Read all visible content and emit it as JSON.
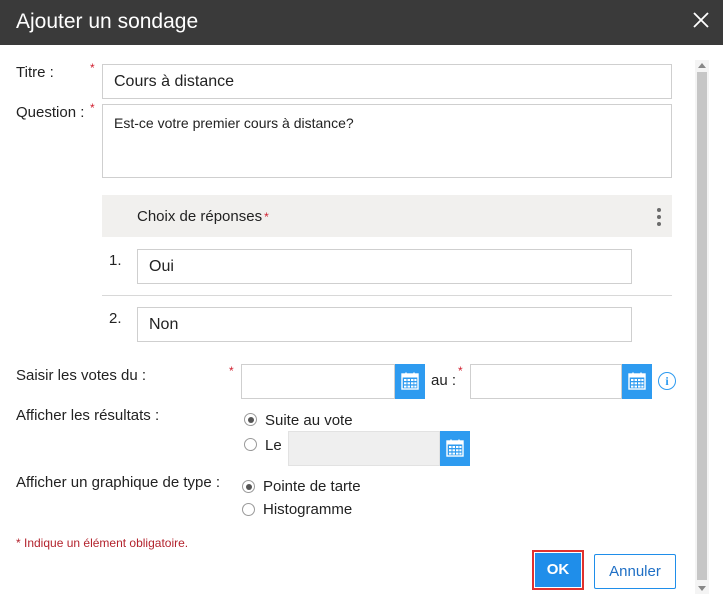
{
  "dialog": {
    "title": "Ajouter un sondage",
    "close_icon": "close-icon"
  },
  "form": {
    "required_mark": "*",
    "title_label": "Titre :",
    "title_value": "Cours à distance",
    "question_label": "Question :",
    "question_value": "Est-ce votre premier cours à distance?",
    "choices_header": "Choix de réponses",
    "choices": [
      {
        "number": "1.",
        "value": "Oui"
      },
      {
        "number": "2.",
        "value": "Non"
      }
    ],
    "votes_label": "Saisir les votes du :",
    "votes_to_label": "au :",
    "votes_from_value": "",
    "votes_to_value": "",
    "results_label": "Afficher les résultats :",
    "results_options": [
      {
        "label": "Suite au vote",
        "checked": true
      },
      {
        "label": "Le",
        "checked": false
      }
    ],
    "results_date_value": "",
    "chart_type_label": "Afficher un graphique de type :",
    "chart_type_options": [
      {
        "label": "Pointe de tarte",
        "checked": true
      },
      {
        "label": "Histogramme",
        "checked": false
      }
    ],
    "required_legend": "* Indique un élément obligatoire."
  },
  "buttons": {
    "ok": "OK",
    "cancel": "Annuler"
  },
  "colors": {
    "titlebar": "#3a3a3a",
    "accent": "#1f8eea",
    "required": "#d01f2f",
    "focus_outline": "#e0312e"
  },
  "icons": {
    "calendar": "calendar-icon",
    "info": "info-icon",
    "kebab": "kebab-menu-icon"
  }
}
